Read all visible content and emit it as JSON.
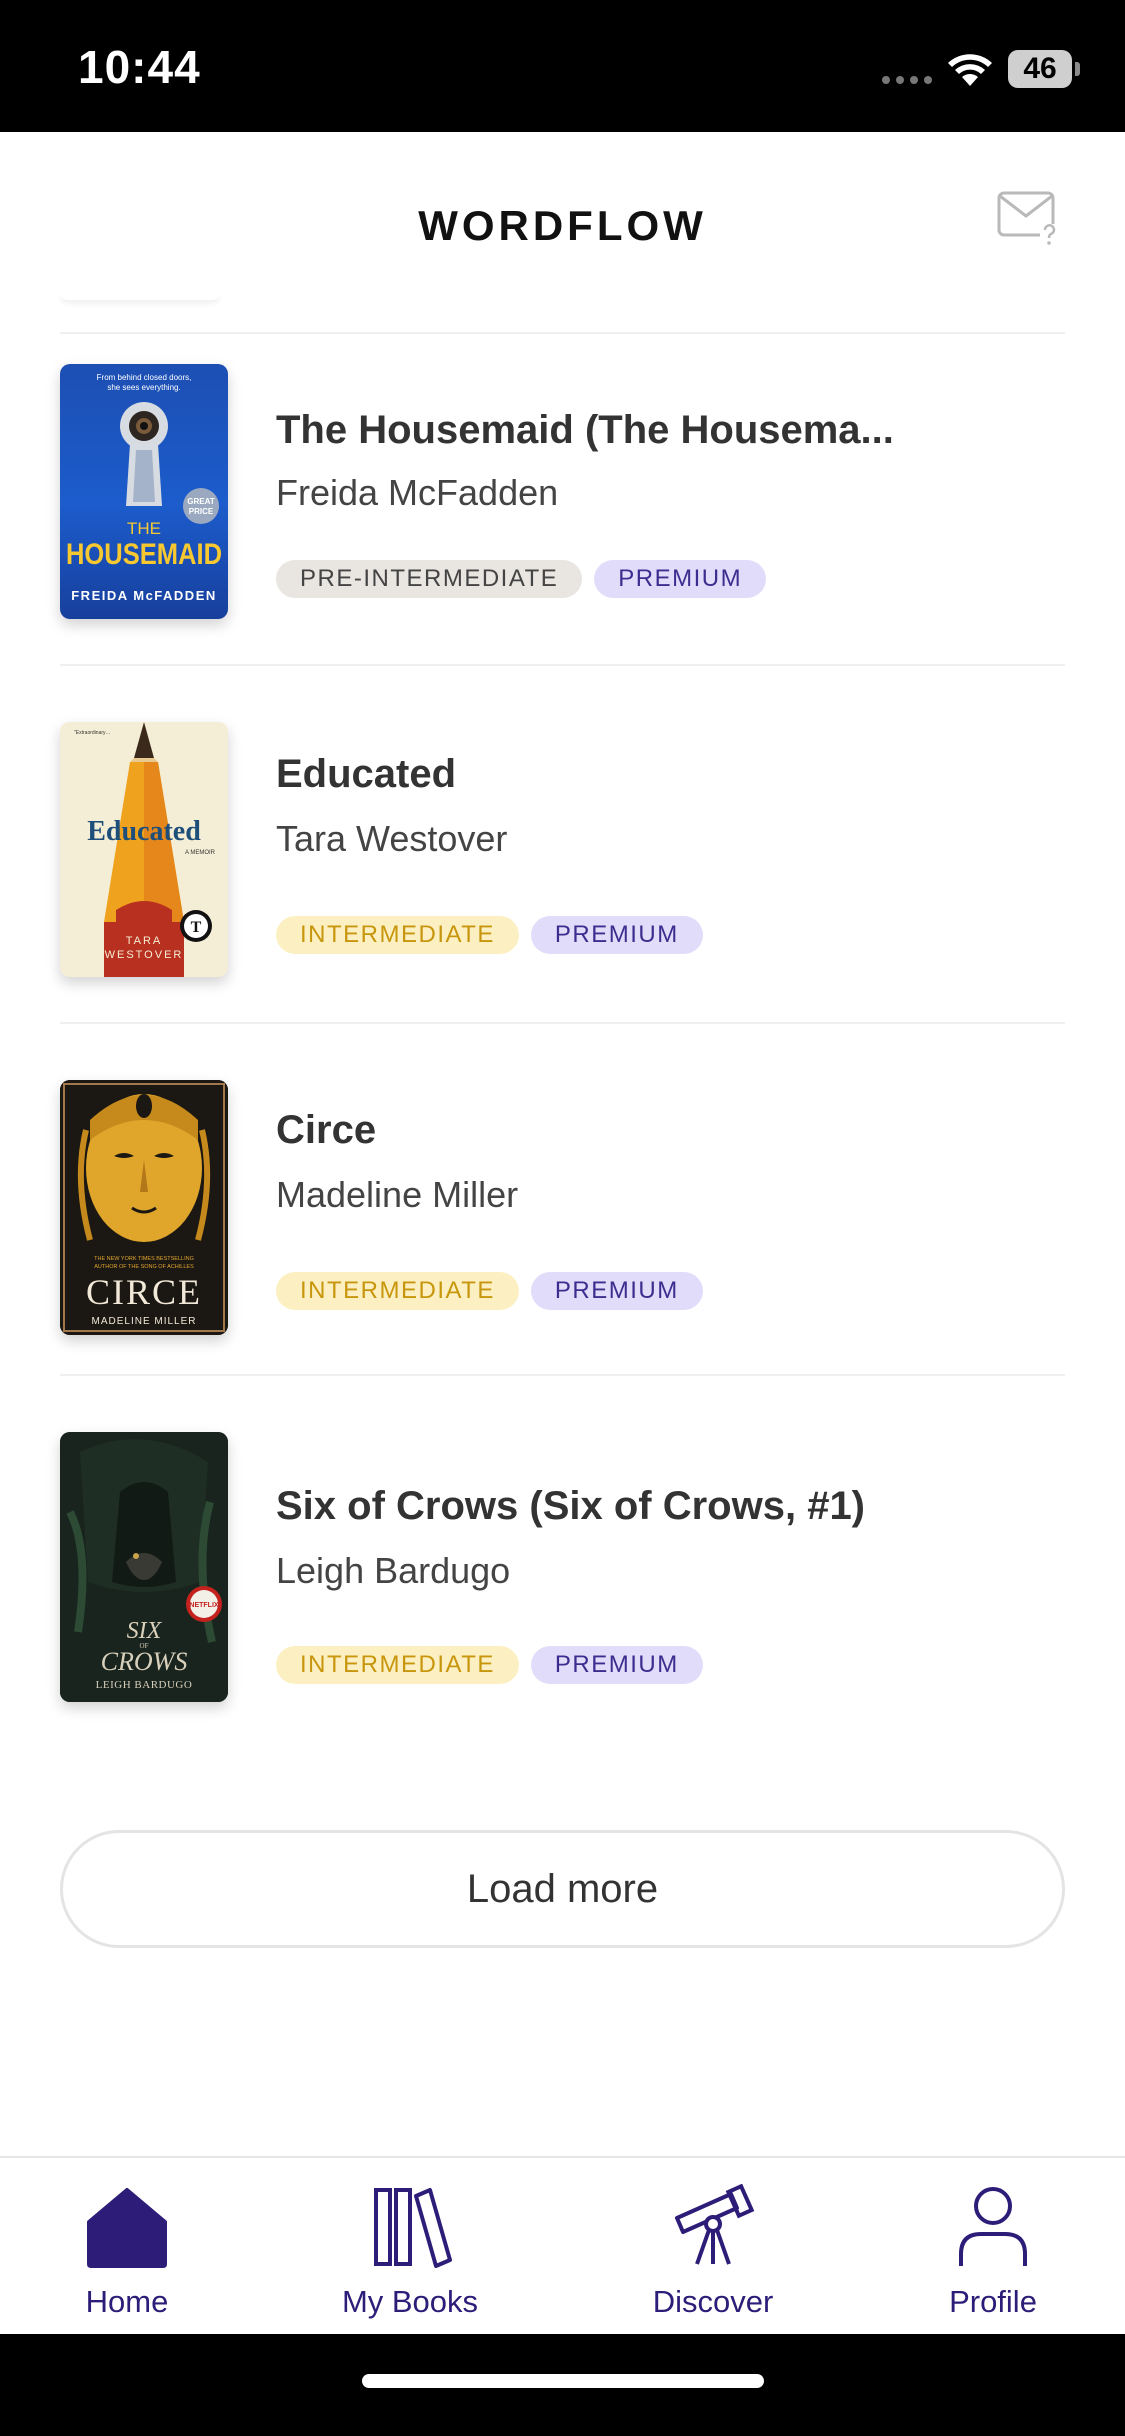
{
  "status_bar": {
    "time": "10:44",
    "battery": "46"
  },
  "header": {
    "title": "WORDFLOW",
    "mail_icon": "mail-question-icon"
  },
  "books": [
    {
      "title": "The Housemaid (The Housema...",
      "author": "Freida McFadden",
      "tags": [
        "PRE-INTERMEDIATE",
        "PREMIUM"
      ],
      "cover": {
        "top": "From behind closed doors, she sees everything.",
        "badge": "GREAT PRICE",
        "title_line1": "THE",
        "title_line2": "HOUSEMAID",
        "author": "FREIDA McFADDEN"
      }
    },
    {
      "title": "Educated",
      "author": "Tara Westover",
      "tags": [
        "INTERMEDIATE",
        "PREMIUM"
      ],
      "cover": {
        "title": "Educated",
        "subtitle": "A MEMOIR",
        "author_line1": "TARA",
        "author_line2": "WESTOVER"
      }
    },
    {
      "title": "Circe",
      "author": "Madeline Miller",
      "tags": [
        "INTERMEDIATE",
        "PREMIUM"
      ],
      "cover": {
        "blurb": "THE NEW YORK TIMES BESTSELLING AUTHOR OF THE SONG OF ACHILLES",
        "title": "CIRCE",
        "author": "MADELINE MILLER"
      }
    },
    {
      "title": "Six of Crows (Six of Crows, #1)",
      "author": "Leigh Bardugo",
      "tags": [
        "INTERMEDIATE",
        "PREMIUM"
      ],
      "cover": {
        "badge": "NETFLIX",
        "title_line1": "SIX",
        "title_line2": "CROWS",
        "author": "LEIGH BARDUGO"
      }
    }
  ],
  "load_more": "Load more",
  "tabs": [
    {
      "label": "Home",
      "icon": "home-icon",
      "active": true
    },
    {
      "label": "My Books",
      "icon": "books-icon",
      "active": false
    },
    {
      "label": "Discover",
      "icon": "telescope-icon",
      "active": false
    },
    {
      "label": "Profile",
      "icon": "person-icon",
      "active": false
    }
  ],
  "colors": {
    "accent": "#2d1d78",
    "premium_bg": "#e2dcfb",
    "intermediate_bg": "#fcf0c2",
    "intermediate_text": "#c8960c",
    "pre_intermediate_bg": "#e9e5e1"
  }
}
